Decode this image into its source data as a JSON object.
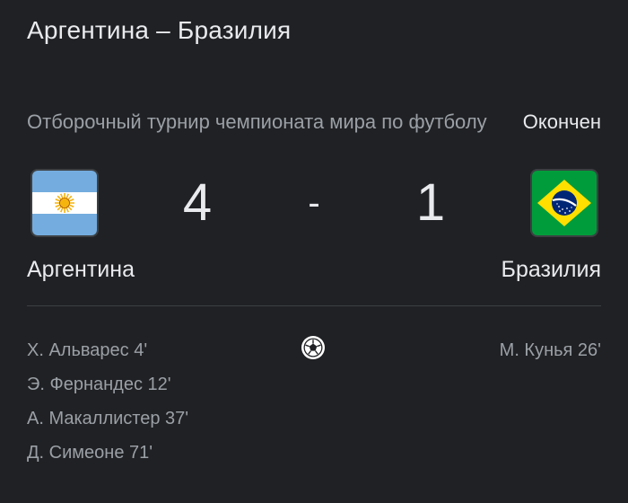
{
  "match": {
    "title": "Аргентина – Бразилия",
    "tournament": "Отборочный турнир чемпионата мира по футболу",
    "status": "Окончен",
    "separator": "-"
  },
  "home": {
    "name": "Аргентина",
    "score": "4",
    "flag_icon": "argentina-flag-icon",
    "scorers": [
      "Х. Альварес 4'",
      "Э. Фернандес 12'",
      "А. Макаллистер 37'",
      "Д. Симеоне 71'"
    ]
  },
  "away": {
    "name": "Бразилия",
    "score": "1",
    "flag_icon": "brazil-flag-icon",
    "scorers": [
      "М. Кунья 26'"
    ]
  },
  "icons": {
    "goal": "soccer-ball-icon"
  },
  "colors": {
    "background": "#202124",
    "primary_text": "#e8eaed",
    "secondary_text": "#9aa0a6",
    "divider": "#3c4043"
  }
}
